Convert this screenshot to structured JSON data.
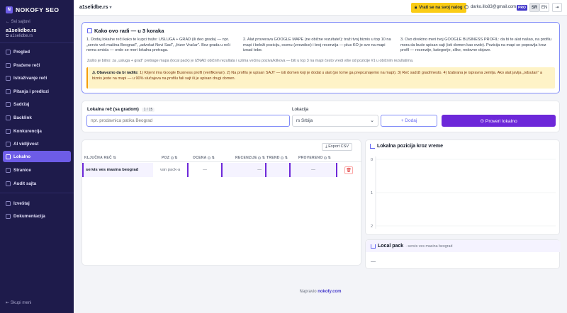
{
  "brand": {
    "name": "NOKOFY SEO"
  },
  "sidebar": {
    "back_label": "← Svi sajtovi",
    "site_name": "a1selidbe.rs",
    "site_link": "⧉ a1selidbe.rs",
    "items": [
      {
        "label": "Pregled"
      },
      {
        "label": "Praćene reči"
      },
      {
        "label": "Istraživanje reči"
      },
      {
        "label": "Pitanja i predlozi"
      },
      {
        "label": "Sadržaj"
      },
      {
        "label": "Backlink"
      },
      {
        "label": "Konkurencija"
      },
      {
        "label": "AI vidljivost"
      },
      {
        "label": "Lokalno"
      },
      {
        "label": "Stranice"
      },
      {
        "label": "Audit sajta"
      }
    ],
    "bottom_items": [
      {
        "label": "Izveštaj"
      },
      {
        "label": "Dokumentacija"
      }
    ],
    "collapse_label": "Skupi meni"
  },
  "topbar": {
    "site": "a1selidbe.rs",
    "return_button": "Vrati se na svoj nalog",
    "user_email": "darko.illo83@gmail.com",
    "plan_badge": "PRO",
    "lang_sr": "SR",
    "lang_en": "EN"
  },
  "how": {
    "title": "Kako ovo radi — u 3 koraka",
    "step1": "1. Dodaj lokalne reči kako te kupci traže: USLUGA + GRAD (ili deo grada) — npr. „servis veš mašina Beograd\", „advokat Novi Sad\", „frizer Vračar\". Bez grada u reči nema smisla — ovde se meri lokalna pretraga.",
    "step2": "2. Alat proverava GOOGLE MAPE (ne obične rezultate!): traži tvoj biznis u top 10 na mapi i beleži poziciju, ocenu (zvezdice) i broj recenzija — plus KO je sve na mapi iznad tebe.",
    "step3": "3. Ovo direktno meri tvoj GOOGLE BUSINESS PROFIL: da bi te alat našao, na profilu mora da bude upisan sajt (isti domen kao ovde). Pozicija na mapi se popravlja kroz profil — recenzije, kategorije, slike, redovne objave.",
    "note": "Zašto je bitno: za „usluga + grad\" pretrage mapa (local pack) je IZNAD običnih rezultata i uzima većinu poziva/klikova — biti u top 3 na mapi često vredi više od pozicije #1 u običnim rezultatima.",
    "warn_title": "⚠ Obavezno da bi radilo:",
    "warn_text": "1) Klijent ima Google Business profil (verifikovan). 2) Na profilu je upisan SAJT — isti domen koji je dodat u alat (po tome ga prepoznajemo na mapi). 3) Reč sadrži grad/mesto. 4) Izabrana je ispravna zemlja. Ako alat javlja „odsutan\" a biznis jeste na mapi — u 90% slučajeva na profilu fali sajt ili je upisan drugi domen."
  },
  "form": {
    "label": "Lokalna reč (sa gradom)",
    "count": "1 / 15",
    "placeholder": "npr. prodavnica patika Beograd",
    "location_label": "Lokacija",
    "location_value": "rs Srbija",
    "add_button": "+ Dodaj",
    "check_button": "⊙ Proveri lokalno"
  },
  "table": {
    "export_label": "⤓ Export CSV",
    "headers": {
      "keyword": "Ključna reč",
      "pos": "Poz",
      "rating": "Ocena",
      "reviews": "Recenzije",
      "trend": "Trend",
      "verified": "Provereno"
    },
    "rows": [
      {
        "keyword": "servis ves masina beograd",
        "pos": "van pack-a",
        "rating": "—",
        "reviews": "—",
        "trend": "",
        "verified": "—"
      }
    ]
  },
  "chart": {
    "title": "Lokalna pozicija kroz vreme"
  },
  "chart_data": {
    "type": "line",
    "title": "Lokalna pozicija kroz vreme",
    "xlabel": "",
    "ylabel": "",
    "ylim": [
      2,
      0
    ],
    "ticks": [
      "0",
      "1",
      "2"
    ],
    "series": []
  },
  "local_pack": {
    "title": "Local pack",
    "subtitle": "· servis ves masina beograd",
    "value": "—"
  },
  "footer": {
    "prefix": "Napravio",
    "brand": "nokofy.com"
  },
  "colors": {
    "accent": "#6d28d9",
    "sidebar": "#1e1b4b",
    "warn": "#fef3c7"
  }
}
